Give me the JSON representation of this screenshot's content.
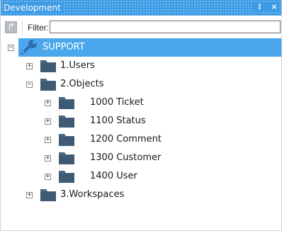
{
  "window": {
    "title": "Development",
    "pin_glyph": "⥑",
    "close_glyph": "×"
  },
  "toolbar": {
    "action_icon": "↱",
    "filter_label": "Filter:",
    "filter_value": ""
  },
  "tree": {
    "root": {
      "label": "SUPPORT",
      "expander": "−",
      "icon": "wrench-icon",
      "selected": true
    },
    "items": [
      {
        "label": "1.Users",
        "expander": "+",
        "icon": "folder-icon"
      },
      {
        "label": "2.Objects",
        "expander": "−",
        "icon": "folder-icon"
      },
      {
        "label": "1000 Ticket",
        "expander": "+",
        "icon": "folder-icon"
      },
      {
        "label": "1100 Status",
        "expander": "+",
        "icon": "folder-icon"
      },
      {
        "label": "1200 Comment",
        "expander": "+",
        "icon": "folder-icon"
      },
      {
        "label": "1300 Customer",
        "expander": "+",
        "icon": "folder-icon"
      },
      {
        "label": "1400 User",
        "expander": "+",
        "icon": "folder-icon"
      },
      {
        "label": "3.Workspaces",
        "expander": "+",
        "icon": "folder-icon"
      }
    ]
  },
  "colors": {
    "title_bar": "#3d9be4",
    "selection": "#4aa7ec",
    "folder": "#4a6681",
    "wrench": "#2f6cb3"
  }
}
